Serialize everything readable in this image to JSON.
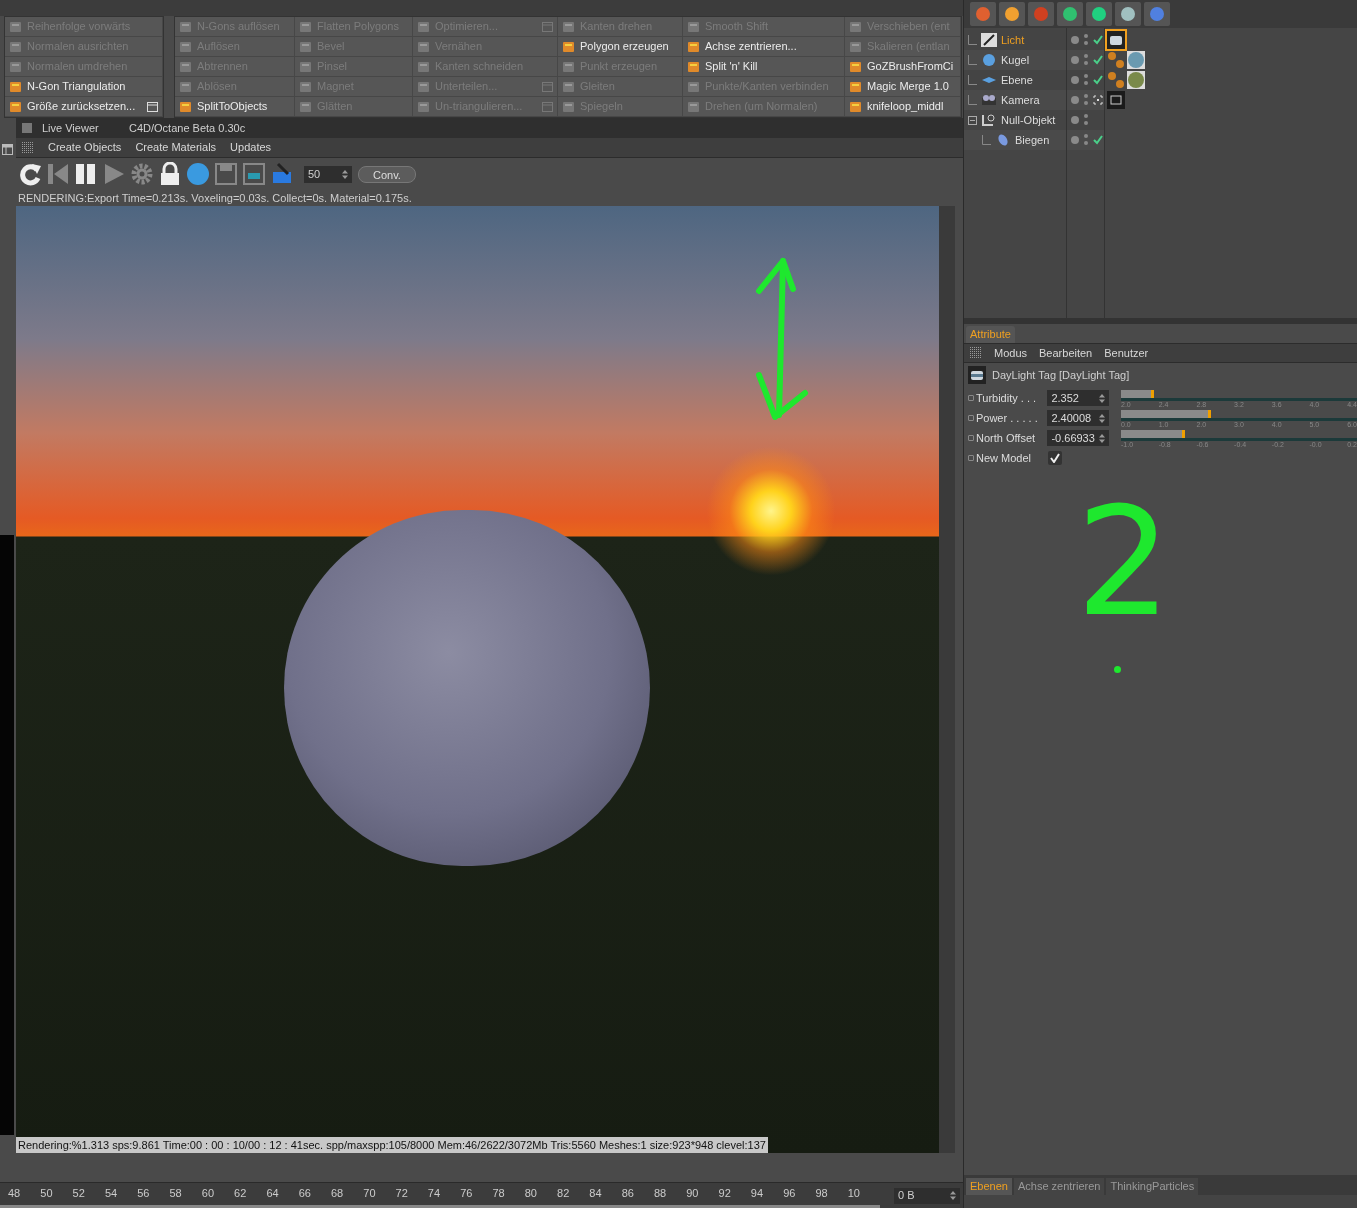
{
  "command_palettes": [
    {
      "columns": [
        [
          {
            "label": "Reihenfolge vorwärts",
            "enabled": false,
            "dialog": false
          },
          {
            "label": "Normalen ausrichten",
            "enabled": false,
            "dialog": false
          },
          {
            "label": "Normalen umdrehen",
            "enabled": false,
            "dialog": false
          },
          {
            "label": "N-Gon Triangulation",
            "enabled": true,
            "dialog": false
          },
          {
            "label": "Größe zurücksetzen...",
            "enabled": true,
            "dialog": true
          }
        ]
      ]
    },
    {
      "columns": [
        [
          {
            "label": "N-Gons auflösen",
            "enabled": false,
            "dialog": false
          },
          {
            "label": "Auflösen",
            "enabled": false,
            "dialog": false
          },
          {
            "label": "Abtrennen",
            "enabled": false,
            "dialog": false
          },
          {
            "label": "Ablösen",
            "enabled": false,
            "dialog": false
          },
          {
            "label": "SplitToObjects",
            "enabled": true,
            "dialog": false
          }
        ],
        [
          {
            "label": "Flatten Polygons",
            "enabled": false,
            "dialog": false
          },
          {
            "label": "Bevel",
            "enabled": false,
            "dialog": false
          },
          {
            "label": "Pinsel",
            "enabled": false,
            "dialog": false
          },
          {
            "label": "Magnet",
            "enabled": false,
            "dialog": false
          },
          {
            "label": "Glätten",
            "enabled": false,
            "dialog": false
          }
        ],
        [
          {
            "label": "Optimieren...",
            "enabled": false,
            "dialog": true
          },
          {
            "label": "Vernähen",
            "enabled": false,
            "dialog": false
          },
          {
            "label": "Kanten schneiden",
            "enabled": false,
            "dialog": false
          },
          {
            "label": "Unterteilen...",
            "enabled": false,
            "dialog": true
          },
          {
            "label": "Un-triangulieren...",
            "enabled": false,
            "dialog": true
          }
        ],
        [
          {
            "label": "Kanten drehen",
            "enabled": false,
            "dialog": false
          },
          {
            "label": "Polygon erzeugen",
            "enabled": true,
            "dialog": false
          },
          {
            "label": "Punkt erzeugen",
            "enabled": false,
            "dialog": false
          },
          {
            "label": "Gleiten",
            "enabled": false,
            "dialog": false
          },
          {
            "label": "Spiegeln",
            "enabled": false,
            "dialog": false
          }
        ],
        [
          {
            "label": "Smooth Shift",
            "enabled": false,
            "dialog": false
          },
          {
            "label": "Achse zentrieren...",
            "enabled": true,
            "dialog": false
          },
          {
            "label": "Split 'n' Kill",
            "enabled": true,
            "dialog": false
          },
          {
            "label": "Punkte/Kanten verbinden",
            "enabled": false,
            "dialog": false
          },
          {
            "label": "Drehen (um Normalen)",
            "enabled": false,
            "dialog": false
          }
        ],
        [
          {
            "label": "Verschieben (ent",
            "enabled": false,
            "dialog": false
          },
          {
            "label": "Skalieren (entlan",
            "enabled": false,
            "dialog": false
          },
          {
            "label": "GoZBrushFromCi",
            "enabled": true,
            "dialog": false
          },
          {
            "label": "Magic Merge 1.0",
            "enabled": true,
            "dialog": false
          },
          {
            "label": "knifeloop_middl",
            "enabled": true,
            "dialog": false
          }
        ]
      ]
    }
  ],
  "live_viewer": {
    "title": "Live Viewer",
    "version": "C4D/Octane Beta 0.30c",
    "menu": [
      "Create Objects",
      "Create Materials",
      "Updates"
    ],
    "samples_field": "50",
    "convert_button": "Conv.",
    "status": "RENDERING:Export Time=0.213s.  Voxeling=0.03s.  Collect=0s. Material=0.175s.",
    "render_info": "Rendering:%1.313 sps:9.861 Time:00 : 00 : 10/00 : 12 : 41sec. spp/maxspp:105/8000 Mem:46/2622/3072Mb Tris:5560 Meshes:1 size:923*948 clevel:137"
  },
  "annotation": {
    "text": "2"
  },
  "timeline": {
    "ticks": [
      "48",
      "50",
      "52",
      "54",
      "56",
      "58",
      "60",
      "62",
      "64",
      "66",
      "68",
      "70",
      "72",
      "74",
      "76",
      "78",
      "80",
      "82",
      "84",
      "86",
      "88",
      "90",
      "92",
      "94",
      "96",
      "98",
      "10"
    ],
    "frame_field": "0 B"
  },
  "objects": [
    {
      "name": "Licht",
      "kind": "light",
      "selected": true,
      "checked": true,
      "tags": [
        {
          "kind": "daylight",
          "selected": true
        }
      ]
    },
    {
      "name": "Kugel",
      "kind": "sphere",
      "selected": false,
      "checked": true,
      "tags": [
        {
          "kind": "phong",
          "selected": false
        },
        {
          "kind": "material",
          "selected": false,
          "color": "#6a9ab0"
        }
      ]
    },
    {
      "name": "Ebene",
      "kind": "plane",
      "selected": false,
      "checked": true,
      "tags": [
        {
          "kind": "phong",
          "selected": false
        },
        {
          "kind": "material",
          "selected": false,
          "color": "#7a8a4a"
        }
      ]
    },
    {
      "name": "Kamera",
      "kind": "camera",
      "selected": false,
      "checked": false,
      "target": true,
      "tags": [
        {
          "kind": "camera",
          "selected": false
        }
      ]
    },
    {
      "name": "Null-Objekt",
      "kind": "null",
      "selected": false,
      "checked": false,
      "expanded": true,
      "children": [
        {
          "name": "Biegen",
          "kind": "bend",
          "selected": false,
          "checked": true
        }
      ]
    }
  ],
  "attributes": {
    "tab": {
      "label": "Attribute",
      "selected": true
    },
    "menu": [
      "Modus",
      "Bearbeiten",
      "Benutzer"
    ],
    "header": "DayLight Tag [DayLight Tag]",
    "params": [
      {
        "label": "Turbidity . . .",
        "value": "2.352",
        "level": 0.14,
        "ticks": [
          "2.0",
          "2.4",
          "2.8",
          "3.2",
          "3.6",
          "4.0",
          "4.4"
        ]
      },
      {
        "label": "Power . . . . .",
        "value": "2.40008",
        "level": 0.38,
        "ticks": [
          "0.0",
          "1.0",
          "2.0",
          "3.0",
          "4.0",
          "5.0",
          "6.0"
        ]
      },
      {
        "label": "North Offset",
        "value": "-0.66933",
        "level": 0.27,
        "ticks": [
          "-1.0",
          "-0.8",
          "-0.6",
          "-0.4",
          "-0.2",
          "-0.0",
          "0.2"
        ]
      }
    ],
    "new_model": {
      "label": "New Model",
      "checked": true
    }
  },
  "bottom_tabs": [
    {
      "label": "Ebenen",
      "selected": true
    },
    {
      "label": "Achse zentrieren",
      "selected": false
    },
    {
      "label": "ThinkingParticles",
      "selected": false
    }
  ]
}
